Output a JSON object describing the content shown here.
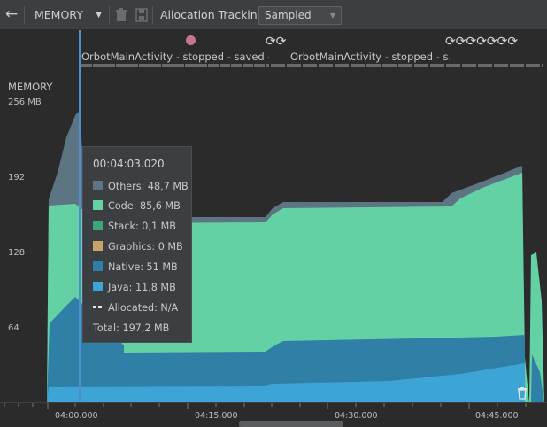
{
  "toolbar": {
    "back_icon": "back-arrow-icon",
    "profiler_label": "MEMORY",
    "delete_icon": "trash-icon",
    "save_icon": "save-icon",
    "allocation_label": "Allocation Tracking",
    "allocation_value": "Sampled"
  },
  "events": {
    "activities": [
      {
        "label": "OrbotMainActivity - stopped - saved -..."
      },
      {
        "label": "OrbotMainActivity - stopped - s..."
      }
    ]
  },
  "memory": {
    "title": "MEMORY",
    "yticks": [
      "256 MB",
      "192",
      "128",
      "64"
    ],
    "xticks": [
      "04:00.000",
      "04:15.000",
      "04:30.000",
      "04:45.000"
    ]
  },
  "tooltip": {
    "time": "00:04:03.020",
    "rows": [
      {
        "label": "Others: 48,7 MB",
        "color": "#5d7583"
      },
      {
        "label": "Code: 85,6 MB",
        "color": "#64d1a4"
      },
      {
        "label": "Stack: 0,1 MB",
        "color": "#3ea77a"
      },
      {
        "label": "Graphics: 0 MB",
        "color": "#c9a46a"
      },
      {
        "label": "Native: 51 MB",
        "color": "#2f7fa7"
      },
      {
        "label": "Java: 11,8 MB",
        "color": "#3da4d6"
      }
    ],
    "allocated": "Allocated: N/A",
    "total": "Total: 197,2 MB"
  },
  "colors": {
    "others": "#5d7583",
    "code": "#64d1a4",
    "native": "#2f7fa7",
    "java": "#3da4d6",
    "cursor": "#4f8fcf",
    "event_dot": "#c77494"
  }
}
